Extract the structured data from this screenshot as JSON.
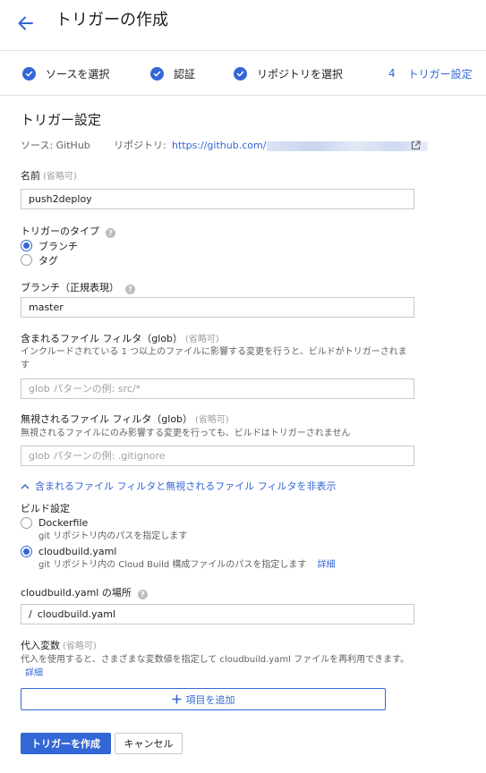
{
  "header": {
    "title": "トリガーの作成"
  },
  "stepper": {
    "steps": [
      {
        "label": "ソースを選択"
      },
      {
        "label": "認証"
      },
      {
        "label": "リポジトリを選択"
      },
      {
        "number": "4",
        "label": "トリガー設定"
      }
    ]
  },
  "section": {
    "title": "トリガー設定"
  },
  "source": {
    "source_text": "ソース: GitHub",
    "repo_label": "リポジトリ:",
    "repo_url": "https://github.com/"
  },
  "name_field": {
    "label": "名前",
    "optional": "(省略可)",
    "value": "push2deploy"
  },
  "trigger_type": {
    "label": "トリガーのタイプ",
    "options": [
      {
        "label": "ブランチ",
        "selected": true
      },
      {
        "label": "タグ",
        "selected": false
      }
    ]
  },
  "branch_field": {
    "label": "ブランチ（正規表現）",
    "value": "master"
  },
  "included_filter": {
    "label": "含まれるファイル フィルタ（glob）",
    "optional": "(省略可)",
    "description": "インクルードされている 1 つ以上のファイルに影響する変更を行うと、ビルドがトリガーされます",
    "placeholder": "glob パターンの例: src/*",
    "value": ""
  },
  "ignored_filter": {
    "label": "無視されるファイル フィルタ（glob）",
    "optional": "(省略可)",
    "description": "無視されるファイルにのみ影響する変更を行っても、ビルドはトリガーされません",
    "placeholder": "glob パターンの例: .gitignore",
    "value": ""
  },
  "filter_toggle": {
    "label": "含まれるファイル フィルタと無視されるファイル フィルタを非表示"
  },
  "build_config": {
    "label": "ビルド設定",
    "options": [
      {
        "label": "Dockerfile",
        "description": "git リポジトリ内のパスを指定します",
        "selected": false
      },
      {
        "label": "cloudbuild.yaml",
        "description": "git リポジトリ内の Cloud Build 構成ファイルのパスを指定します",
        "link": "詳細",
        "selected": true
      }
    ]
  },
  "cloudbuild_location": {
    "label": "cloudbuild.yaml の場所",
    "prefix": "/",
    "value": "cloudbuild.yaml"
  },
  "substitutions": {
    "label": "代入変数",
    "optional": "(省略可)",
    "description": "代入を使用すると、さまざまな変数値を指定して cloudbuild.yaml ファイルを再利用できます。",
    "link": "詳細",
    "add_label": "項目を追加"
  },
  "actions": {
    "create_label": "トリガーを作成",
    "cancel_label": "キャンセル"
  },
  "colors": {
    "accent": "#3367d6",
    "border": "#e0e0e0",
    "muted": "#9e9e9e"
  }
}
